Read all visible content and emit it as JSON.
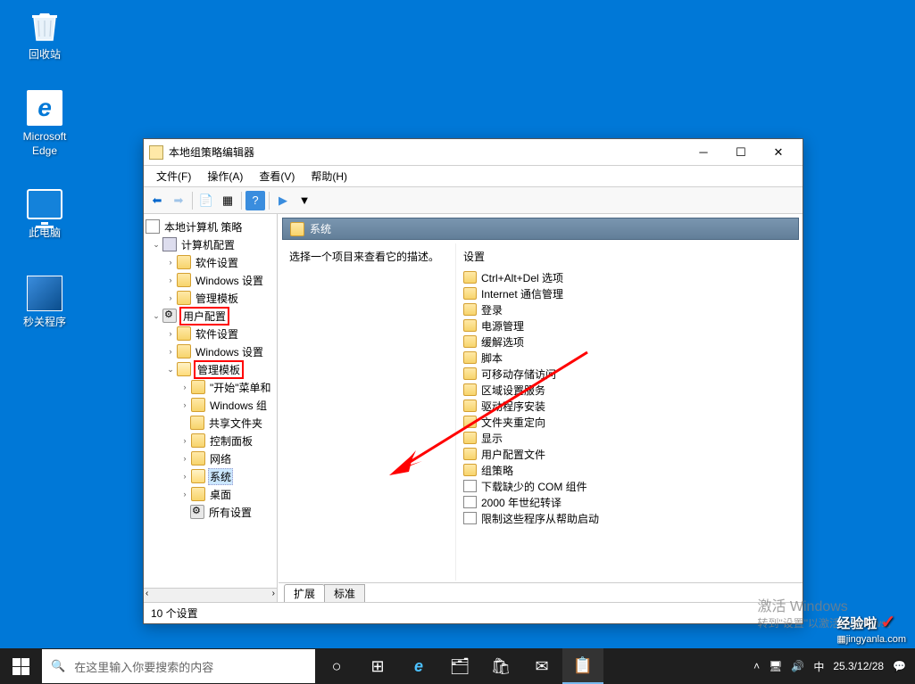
{
  "desktop": {
    "recycle": "回收站",
    "edge": "Microsoft Edge",
    "pc": "此电脑",
    "tool": "秒关程序"
  },
  "window": {
    "title": "本地组策略编辑器",
    "menu": {
      "file": "文件(F)",
      "action": "操作(A)",
      "view": "查看(V)",
      "help": "帮助(H)"
    },
    "content_header": "系统",
    "desc_placeholder": "选择一个项目来查看它的描述。",
    "list_header": "设置",
    "tabs": {
      "extended": "扩展",
      "standard": "标准"
    },
    "status": "10 个设置"
  },
  "tree": {
    "root": "本地计算机 策略",
    "computer_config": "计算机配置",
    "software_settings": "软件设置",
    "windows_settings": "Windows 设置",
    "admin_templates": "管理模板",
    "user_config": "用户配置",
    "start_menu": "\"开始\"菜单和",
    "windows_comp": "Windows 组",
    "shared_folders": "共享文件夹",
    "control_panel": "控制面板",
    "network": "网络",
    "system": "系统",
    "desktop_node": "桌面",
    "all_settings": "所有设置"
  },
  "settings_list": [
    {
      "label": "Ctrl+Alt+Del 选项",
      "type": "folder"
    },
    {
      "label": "Internet 通信管理",
      "type": "folder"
    },
    {
      "label": "登录",
      "type": "folder"
    },
    {
      "label": "电源管理",
      "type": "folder"
    },
    {
      "label": "缓解选项",
      "type": "folder"
    },
    {
      "label": "脚本",
      "type": "folder"
    },
    {
      "label": "可移动存储访问",
      "type": "folder"
    },
    {
      "label": "区域设置服务",
      "type": "folder"
    },
    {
      "label": "驱动程序安装",
      "type": "folder"
    },
    {
      "label": "文件夹重定向",
      "type": "folder"
    },
    {
      "label": "显示",
      "type": "folder"
    },
    {
      "label": "用户配置文件",
      "type": "folder"
    },
    {
      "label": "组策略",
      "type": "folder"
    },
    {
      "label": "下载缺少的 COM 组件",
      "type": "page"
    },
    {
      "label": "2000 年世纪转译",
      "type": "page"
    },
    {
      "label": "限制这些程序从帮助启动",
      "type": "page"
    }
  ],
  "watermark": {
    "line1": "激活 Windows",
    "line2": "转到\"设置\"以激活 Windows。"
  },
  "taskbar": {
    "search_placeholder": "在这里输入你要搜索的内容",
    "date": "25.3/12/28"
  },
  "brand": {
    "name": "经验啦",
    "url": "▦jingyanla.com"
  }
}
